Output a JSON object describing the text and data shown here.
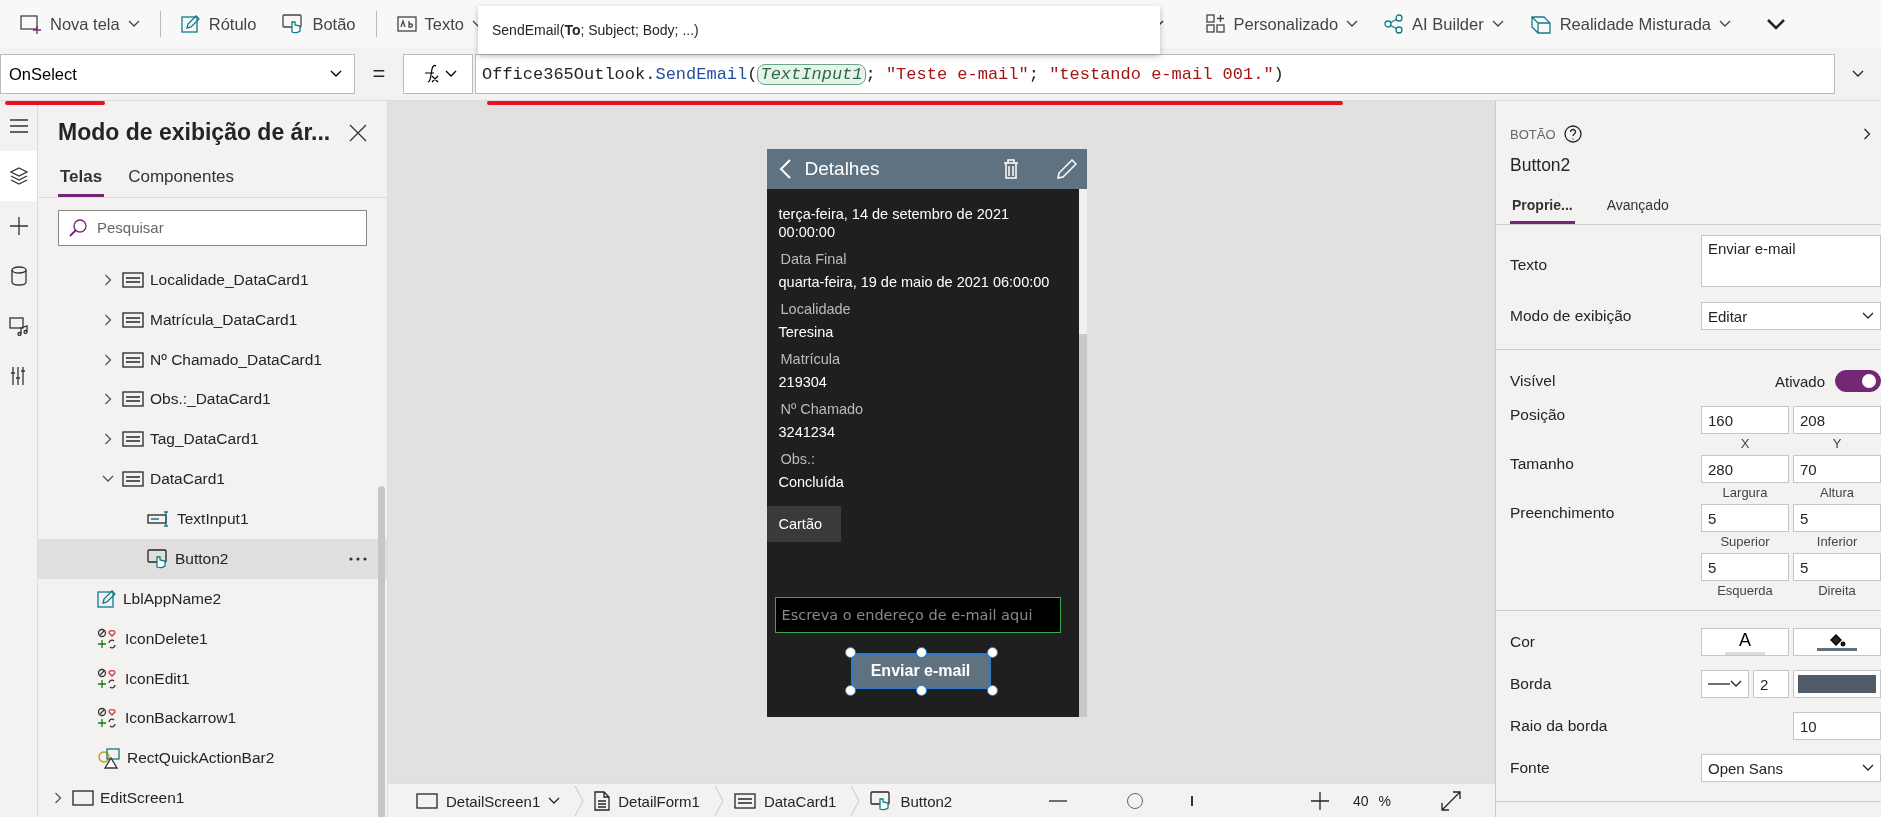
{
  "toolbar": {
    "insert_items": [
      {
        "label": "Nova tela",
        "kind": "new_screen",
        "dropdown": true
      },
      {
        "label": "Rótulo",
        "kind": "label",
        "dropdown": false
      },
      {
        "label": "Botão",
        "kind": "button",
        "dropdown": false
      },
      {
        "label": "Texto",
        "kind": "text",
        "dropdown": true
      }
    ],
    "right_items": [
      {
        "label": "Personalizado",
        "kind": "custom",
        "dropdown": true
      },
      {
        "label": "AI Builder",
        "kind": "ai",
        "dropdown": true
      },
      {
        "label": "Realidade Misturada",
        "kind": "mixed_reality",
        "dropdown": true
      }
    ]
  },
  "tooltip": "SendEmail(**To**; Subject; Body; ...)",
  "formula_bar": {
    "property": "OnSelect",
    "equals": "=",
    "tokens": [
      {
        "text": "Office365Outlook.",
        "kind": "plain"
      },
      {
        "text": "SendEmail",
        "kind": "function"
      },
      {
        "text": "(",
        "kind": "plain"
      },
      {
        "text": "TextInput1",
        "kind": "reference"
      },
      {
        "text": "; ",
        "kind": "plain"
      },
      {
        "text": "\"Teste e-mail\"",
        "kind": "string"
      },
      {
        "text": "; ",
        "kind": "plain"
      },
      {
        "text": "\"testando e-mail 001.\"",
        "kind": "string"
      },
      {
        "text": ")",
        "kind": "plain"
      }
    ]
  },
  "rail": [
    {
      "kind": "menu",
      "selected": false
    },
    {
      "kind": "layers",
      "selected": true
    },
    {
      "kind": "insert",
      "selected": false
    },
    {
      "kind": "data",
      "selected": false
    },
    {
      "kind": "media",
      "selected": false
    },
    {
      "kind": "tools",
      "selected": false
    }
  ],
  "tree_panel": {
    "title": "Modo de exibição de ár...",
    "tabs": [
      {
        "label": "Telas",
        "selected": true
      },
      {
        "label": "Componentes",
        "selected": false
      }
    ],
    "search": {
      "placeholder": "Pesquisar"
    },
    "tree": [
      {
        "children": [
          {
            "children": [
              {
                "label": "Localidade_DataCard1",
                "kind": "card",
                "expanded": false,
                "selected": false
              },
              {
                "label": "Matrícula_DataCard1",
                "kind": "card",
                "expanded": false,
                "selected": false
              },
              {
                "label": "Nº Chamado_DataCard1",
                "kind": "card",
                "expanded": false,
                "selected": false
              },
              {
                "label": "Obs.:_DataCard1",
                "kind": "card",
                "expanded": false,
                "selected": false
              },
              {
                "label": "Tag_DataCard1",
                "kind": "card",
                "expanded": false,
                "selected": false
              },
              {
                "label": "DataCard1",
                "kind": "card",
                "expanded": true,
                "selected": false,
                "children": [
                  {
                    "label": "TextInput1",
                    "kind": "text_input",
                    "selected": false
                  },
                  {
                    "label": "Button2",
                    "kind": "button",
                    "selected": true
                  }
                ]
              }
            ]
          },
          {
            "label": "LblAppName2",
            "kind": "label",
            "selected": false
          },
          {
            "label": "IconDelete1",
            "kind": "icon",
            "selected": false
          },
          {
            "label": "IconEdit1",
            "kind": "icon",
            "selected": false
          },
          {
            "label": "IconBackarrow1",
            "kind": "icon",
            "selected": false
          },
          {
            "label": "RectQuickActionBar2",
            "kind": "rectangle",
            "selected": false
          }
        ]
      },
      {
        "label": "EditScreen1",
        "kind": "screen",
        "expanded": false,
        "selected": false
      }
    ]
  },
  "app_screen": {
    "title": "Detalhes",
    "fields": [
      {
        "value": "terça-feira, 14 de setembro de 2021 00:00:00"
      },
      {
        "label": "Data Final",
        "value": "quarta-feira, 19 de maio de 2021 06:00:00"
      },
      {
        "label": "Localidade",
        "value": "Teresina"
      },
      {
        "label": "Matrícula",
        "value": "219304"
      },
      {
        "label": "Nº Chamado",
        "value": "3241234"
      },
      {
        "label": "Obs.:",
        "value": "Concluída"
      }
    ],
    "tooltip": "Cartão",
    "email_input": {
      "placeholder": "Escreva o endereço de e-mail aqui"
    },
    "button": {
      "label": "Enviar e-mail",
      "selected": true
    }
  },
  "properties": {
    "type": "BOTÃO",
    "name": "Button2",
    "tabs": [
      {
        "label": "Proprie...",
        "selected": true
      },
      {
        "label": "Avançado",
        "selected": false
      }
    ],
    "sections": [
      [
        {
          "kind": "textarea",
          "label": "Texto",
          "value": "Enviar e-mail"
        },
        {
          "kind": "dropdown",
          "label": "Modo de exibição",
          "value": "Editar"
        }
      ],
      [
        {
          "kind": "toggle",
          "label": "Visível",
          "state_label": "Ativado",
          "on": true
        },
        {
          "kind": "pair",
          "label": "Posição",
          "fields": [
            {
              "value": "160",
              "caption": "X"
            },
            {
              "value": "208",
              "caption": "Y"
            }
          ]
        },
        {
          "kind": "pair",
          "label": "Tamanho",
          "fields": [
            {
              "value": "280",
              "caption": "Largura"
            },
            {
              "value": "70",
              "caption": "Altura"
            }
          ]
        },
        {
          "kind": "pair",
          "label": "Preenchimento",
          "fields": [
            {
              "value": "5",
              "caption": "Superior"
            },
            {
              "value": "5",
              "caption": "Inferior"
            }
          ]
        },
        {
          "kind": "pair",
          "fields": [
            {
              "value": "5",
              "caption": "Esquerda"
            },
            {
              "value": "5",
              "caption": "Direita"
            }
          ]
        }
      ],
      [
        {
          "kind": "color",
          "label": "Cor",
          "glyph": "A"
        },
        {
          "kind": "border",
          "label": "Borda",
          "value": "2"
        },
        {
          "kind": "number",
          "label": "Raio da borda",
          "value": "10"
        },
        {
          "kind": "dropdown",
          "label": "Fonte",
          "value": "Open Sans"
        }
      ]
    ]
  },
  "bottom_bar": {
    "breadcrumbs": [
      {
        "label": "DetailScreen1",
        "kind": "screen",
        "dropdown": true
      },
      {
        "label": "DetailForm1",
        "kind": "form",
        "dropdown": false
      },
      {
        "label": "DataCard1",
        "kind": "card",
        "dropdown": false
      },
      {
        "label": "Button2",
        "kind": "button",
        "dropdown": false
      }
    ],
    "zoom": {
      "level": 0.22,
      "value": "40",
      "unit": "%"
    }
  }
}
